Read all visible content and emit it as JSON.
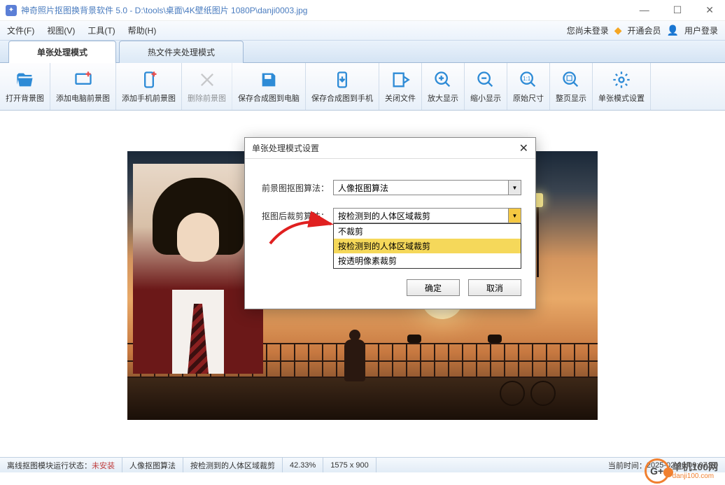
{
  "window": {
    "title": "神奇照片抠图换背景软件 5.0 - D:\\tools\\桌面\\4K壁纸图片 1080P\\danji0003.jpg"
  },
  "menu": {
    "file": "文件(F)",
    "view": "视图(V)",
    "tools": "工具(T)",
    "help": "帮助(H)",
    "not_logged": "您尚未登录",
    "open_member": "开通会员",
    "user_login": "用户登录"
  },
  "tabs": {
    "single": "单张处理模式",
    "folder": "热文件夹处理模式"
  },
  "toolbar": {
    "open_bg": "打开背景图",
    "add_pc_fg": "添加电脑前景图",
    "add_phone_fg": "添加手机前景图",
    "del_fg": "删除前景图",
    "save_pc": "保存合成图到电脑",
    "save_phone": "保存合成图到手机",
    "close_file": "关闭文件",
    "zoom_in": "放大显示",
    "zoom_out": "缩小显示",
    "orig_size": "原始尺寸",
    "fit_page": "整页显示",
    "single_settings": "单张模式设置"
  },
  "dialog": {
    "title": "单张处理模式设置",
    "fg_algo_label": "前景图抠图算法：",
    "fg_algo_value": "人像抠图算法",
    "crop_algo_label": "抠图后裁剪算法：",
    "crop_algo_value": "按检测到的人体区域裁剪",
    "options": {
      "opt1": "不裁剪",
      "opt2": "按检测到的人体区域裁剪",
      "opt3": "按透明像素裁剪"
    },
    "ok": "确定",
    "cancel": "取消"
  },
  "status": {
    "offline_label": "离线抠图模块运行状态：",
    "offline_value": "未安装",
    "algo": "人像抠图算法",
    "crop": "按检测到的人体区域裁剪",
    "zoom": "42.33%",
    "dims": "1575 x 900",
    "time_label": "当前时间：",
    "time_value": "2025-02-20 09:07:10"
  },
  "watermark": {
    "name": "单机100网",
    "url": "danji100.com",
    "icon_text": "G+"
  }
}
